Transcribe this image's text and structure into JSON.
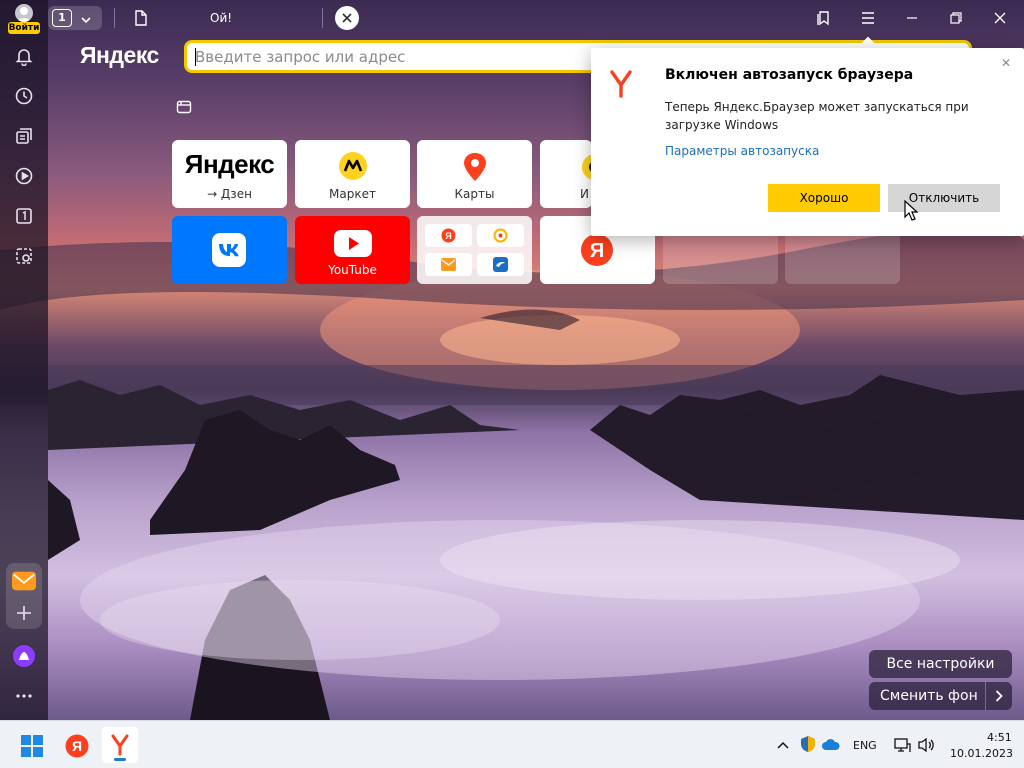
{
  "titlebar": {
    "login_label": "Войти",
    "tab_count": "1",
    "active_tab_title": "Ой!"
  },
  "address_bar": {
    "logo": "Яндекс",
    "placeholder": "Введите запрос или адрес",
    "value": ""
  },
  "tiles": [
    {
      "id": "yandex-dzen",
      "logo": "Яндекс",
      "label": "→ Дзен"
    },
    {
      "id": "market",
      "label": "Маркет"
    },
    {
      "id": "maps",
      "label": "Карты"
    },
    {
      "id": "partial",
      "label": "И"
    },
    {
      "id": "vk",
      "label": ""
    },
    {
      "id": "youtube",
      "label": "YouTube"
    },
    {
      "id": "yandex-group",
      "label": ""
    },
    {
      "id": "yandex",
      "label": ""
    },
    {
      "id": "empty-1",
      "label": ""
    },
    {
      "id": "empty-2",
      "label": ""
    }
  ],
  "popup": {
    "title": "Включен автозапуск браузера",
    "body": "Теперь Яндекс.Браузер может запускаться при загрузке Windows",
    "link": "Параметры автозапуска",
    "ok_label": "Хорошо",
    "off_label": "Отключить"
  },
  "bottom_buttons": {
    "all_settings": "Все настройки",
    "change_bg": "Сменить фон"
  },
  "taskbar": {
    "lang": "ENG",
    "time": "4:51",
    "date": "10.01.2023"
  },
  "colors": {
    "accent_yellow": "#ffcc00",
    "yandex_red": "#fc3f1d",
    "link_blue": "#1a6fc4",
    "vk_blue": "#0077ff",
    "youtube_red": "#ff0000"
  }
}
